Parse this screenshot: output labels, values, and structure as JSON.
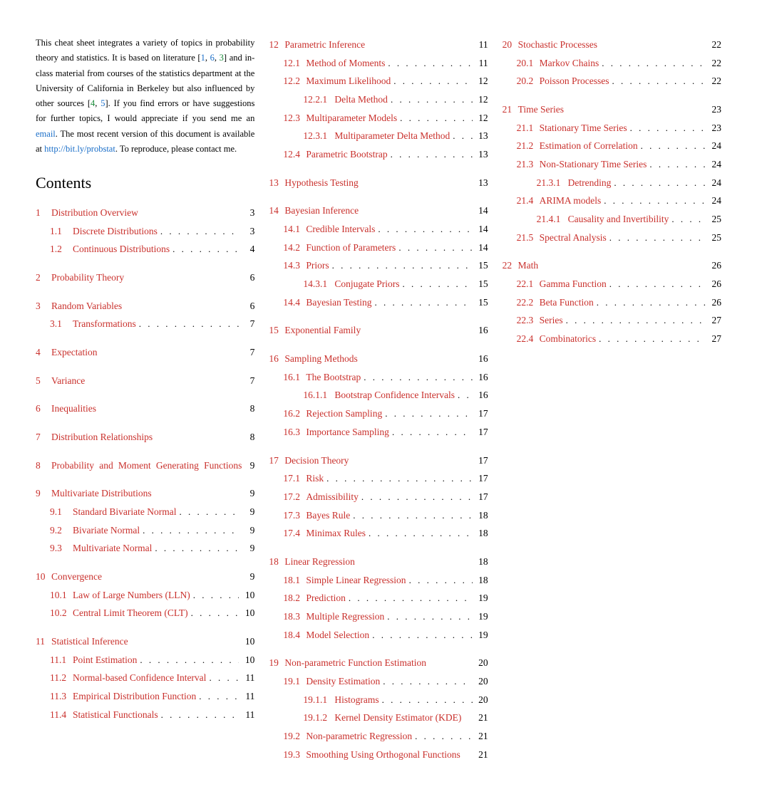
{
  "intro": {
    "p1a": "This cheat sheet integrates a variety of topics in probability theory and statistics. It is based on literature [",
    "cite1": "1",
    "cite2": "6",
    "cite3": "3",
    "p1b": "] and in-class material from courses of the statistics department at the University of California in Berkeley but also influenced by other sources [",
    "cite4": "4",
    "cite5": "5",
    "p1c": "]. If you find errors or have suggestions for further topics, I would appreciate if you send me an ",
    "email": "email",
    "p1d": ". The most recent version of this document is available at ",
    "url": "http://bit.ly/probstat",
    "p1e": ". To reproduce, please contact me."
  },
  "contents_title": "Contents",
  "cols": [
    [
      {
        "type": "sec",
        "items": [
          {
            "l": 0,
            "n": "1",
            "t": "Distribution Overview",
            "p": "3",
            "nodot": true
          },
          {
            "l": 1,
            "n": "1.1",
            "t": "Discrete Distributions",
            "p": "3"
          },
          {
            "l": 1,
            "n": "1.2",
            "t": "Continuous Distributions",
            "p": "4"
          }
        ]
      },
      {
        "type": "sec",
        "items": [
          {
            "l": 0,
            "n": "2",
            "t": "Probability Theory",
            "p": "6",
            "nodot": true
          }
        ]
      },
      {
        "type": "sec",
        "items": [
          {
            "l": 0,
            "n": "3",
            "t": "Random Variables",
            "p": "6",
            "nodot": true
          },
          {
            "l": 1,
            "n": "3.1",
            "t": "Transformations",
            "p": "7"
          }
        ]
      },
      {
        "type": "sec",
        "items": [
          {
            "l": 0,
            "n": "4",
            "t": "Expectation",
            "p": "7",
            "nodot": true
          }
        ]
      },
      {
        "type": "sec",
        "items": [
          {
            "l": 0,
            "n": "5",
            "t": "Variance",
            "p": "7",
            "nodot": true
          }
        ]
      },
      {
        "type": "sec",
        "items": [
          {
            "l": 0,
            "n": "6",
            "t": "Inequalities",
            "p": "8",
            "nodot": true
          }
        ]
      },
      {
        "type": "sec",
        "items": [
          {
            "l": 0,
            "n": "7",
            "t": "Distribution Relationships",
            "p": "8",
            "nodot": true
          }
        ]
      },
      {
        "type": "sec",
        "items": [
          {
            "l": 0,
            "n": "8",
            "t": "Probability and Moment Generating Functions",
            "p": "9",
            "nodot": true,
            "wrap": true,
            "justify": true
          }
        ]
      },
      {
        "type": "sec",
        "items": [
          {
            "l": 0,
            "n": "9",
            "t": "Multivariate Distributions",
            "p": "9",
            "nodot": true
          },
          {
            "l": 1,
            "n": "9.1",
            "t": "Standard Bivariate Normal",
            "p": "9"
          },
          {
            "l": 1,
            "n": "9.2",
            "t": "Bivariate Normal",
            "p": "9"
          },
          {
            "l": 1,
            "n": "9.3",
            "t": "Multivariate Normal",
            "p": "9"
          }
        ]
      },
      {
        "type": "sec",
        "items": [
          {
            "l": 0,
            "n": "10",
            "t": "Convergence",
            "p": "9",
            "nodot": true
          },
          {
            "l": 1,
            "n": "10.1",
            "t": "Law of Large Numbers (LLN)",
            "p": "10"
          },
          {
            "l": 1,
            "n": "10.2",
            "t": "Central Limit Theorem (CLT)",
            "p": "10"
          }
        ]
      },
      {
        "type": "sec",
        "items": [
          {
            "l": 0,
            "n": "11",
            "t": "Statistical Inference",
            "p": "10",
            "nodot": true
          },
          {
            "l": 1,
            "n": "11.1",
            "t": "Point Estimation",
            "p": "10"
          },
          {
            "l": 1,
            "n": "11.2",
            "t": "Normal-based Confidence Interval",
            "p": "11"
          },
          {
            "l": 1,
            "n": "11.3",
            "t": "Empirical Distribution Function",
            "p": "11"
          },
          {
            "l": 1,
            "n": "11.4",
            "t": "Statistical Functionals",
            "p": "11"
          }
        ]
      }
    ],
    [
      {
        "type": "sec",
        "items": [
          {
            "l": 0,
            "n": "12",
            "t": "Parametric Inference",
            "p": "11",
            "nodot": true
          },
          {
            "l": 1,
            "n": "12.1",
            "t": "Method of Moments",
            "p": "11"
          },
          {
            "l": 1,
            "n": "12.2",
            "t": "Maximum Likelihood",
            "p": "12"
          },
          {
            "l": 2,
            "n": "12.2.1",
            "t": "Delta Method",
            "p": "12"
          },
          {
            "l": 1,
            "n": "12.3",
            "t": "Multiparameter Models",
            "p": "12"
          },
          {
            "l": 2,
            "n": "12.3.1",
            "t": "Multiparameter Delta Method",
            "p": "13"
          },
          {
            "l": 1,
            "n": "12.4",
            "t": "Parametric Bootstrap",
            "p": "13"
          }
        ]
      },
      {
        "type": "sec",
        "items": [
          {
            "l": 0,
            "n": "13",
            "t": "Hypothesis Testing",
            "p": "13",
            "nodot": true
          }
        ]
      },
      {
        "type": "sec",
        "items": [
          {
            "l": 0,
            "n": "14",
            "t": "Bayesian Inference",
            "p": "14",
            "nodot": true
          },
          {
            "l": 1,
            "n": "14.1",
            "t": "Credible Intervals",
            "p": "14"
          },
          {
            "l": 1,
            "n": "14.2",
            "t": "Function of Parameters",
            "p": "14"
          },
          {
            "l": 1,
            "n": "14.3",
            "t": "Priors",
            "p": "15"
          },
          {
            "l": 2,
            "n": "14.3.1",
            "t": "Conjugate Priors",
            "p": "15"
          },
          {
            "l": 1,
            "n": "14.4",
            "t": "Bayesian Testing",
            "p": "15"
          }
        ]
      },
      {
        "type": "sec",
        "items": [
          {
            "l": 0,
            "n": "15",
            "t": "Exponential Family",
            "p": "16",
            "nodot": true
          }
        ]
      },
      {
        "type": "sec",
        "items": [
          {
            "l": 0,
            "n": "16",
            "t": "Sampling Methods",
            "p": "16",
            "nodot": true
          },
          {
            "l": 1,
            "n": "16.1",
            "t": "The Bootstrap",
            "p": "16"
          },
          {
            "l": 2,
            "n": "16.1.1",
            "t": "Bootstrap Confidence Intervals",
            "p": "16"
          },
          {
            "l": 1,
            "n": "16.2",
            "t": "Rejection Sampling",
            "p": "17"
          },
          {
            "l": 1,
            "n": "16.3",
            "t": "Importance Sampling",
            "p": "17"
          }
        ]
      },
      {
        "type": "sec",
        "items": [
          {
            "l": 0,
            "n": "17",
            "t": "Decision Theory",
            "p": "17",
            "nodot": true
          },
          {
            "l": 1,
            "n": "17.1",
            "t": "Risk",
            "p": "17"
          },
          {
            "l": 1,
            "n": "17.2",
            "t": "Admissibility",
            "p": "17"
          },
          {
            "l": 1,
            "n": "17.3",
            "t": "Bayes Rule",
            "p": "18"
          },
          {
            "l": 1,
            "n": "17.4",
            "t": "Minimax Rules",
            "p": "18"
          }
        ]
      },
      {
        "type": "sec",
        "items": [
          {
            "l": 0,
            "n": "18",
            "t": "Linear Regression",
            "p": "18",
            "nodot": true
          },
          {
            "l": 1,
            "n": "18.1",
            "t": "Simple Linear Regression",
            "p": "18"
          },
          {
            "l": 1,
            "n": "18.2",
            "t": "Prediction",
            "p": "19"
          },
          {
            "l": 1,
            "n": "18.3",
            "t": "Multiple Regression",
            "p": "19"
          },
          {
            "l": 1,
            "n": "18.4",
            "t": "Model Selection",
            "p": "19"
          }
        ]
      },
      {
        "type": "sec",
        "items": [
          {
            "l": 0,
            "n": "19",
            "t": "Non-parametric Function Estimation",
            "p": "20",
            "nodot": true
          },
          {
            "l": 1,
            "n": "19.1",
            "t": "Density Estimation",
            "p": "20"
          },
          {
            "l": 2,
            "n": "19.1.1",
            "t": "Histograms",
            "p": "20"
          },
          {
            "l": 2,
            "n": "19.1.2",
            "t": "Kernel Density Estimator (KDE)",
            "p": "21",
            "nodot": true
          },
          {
            "l": 1,
            "n": "19.2",
            "t": "Non-parametric Regression",
            "p": "21"
          },
          {
            "l": 1,
            "n": "19.3",
            "t": "Smoothing Using Orthogonal Functions",
            "p": "21",
            "nodot": true
          }
        ]
      }
    ],
    [
      {
        "type": "sec",
        "items": [
          {
            "l": 0,
            "n": "20",
            "t": "Stochastic Processes",
            "p": "22",
            "nodot": true
          },
          {
            "l": 1,
            "n": "20.1",
            "t": "Markov Chains",
            "p": "22"
          },
          {
            "l": 1,
            "n": "20.2",
            "t": "Poisson Processes",
            "p": "22"
          }
        ]
      },
      {
        "type": "sec",
        "items": [
          {
            "l": 0,
            "n": "21",
            "t": "Time Series",
            "p": "23",
            "nodot": true
          },
          {
            "l": 1,
            "n": "21.1",
            "t": "Stationary Time Series",
            "p": "23"
          },
          {
            "l": 1,
            "n": "21.2",
            "t": "Estimation of Correlation",
            "p": "24"
          },
          {
            "l": 1,
            "n": "21.3",
            "t": "Non-Stationary Time Series",
            "p": "24"
          },
          {
            "l": 2,
            "n": "21.3.1",
            "t": "Detrending",
            "p": "24"
          },
          {
            "l": 1,
            "n": "21.4",
            "t": "ARIMA models",
            "p": "24"
          },
          {
            "l": 2,
            "n": "21.4.1",
            "t": "Causality and Invertibility",
            "p": "25"
          },
          {
            "l": 1,
            "n": "21.5",
            "t": "Spectral Analysis",
            "p": "25"
          }
        ]
      },
      {
        "type": "sec",
        "items": [
          {
            "l": 0,
            "n": "22",
            "t": "Math",
            "p": "26",
            "nodot": true
          },
          {
            "l": 1,
            "n": "22.1",
            "t": "Gamma Function",
            "p": "26"
          },
          {
            "l": 1,
            "n": "22.2",
            "t": "Beta Function",
            "p": "26"
          },
          {
            "l": 1,
            "n": "22.3",
            "t": "Series",
            "p": "27"
          },
          {
            "l": 1,
            "n": "22.4",
            "t": "Combinatorics",
            "p": "27"
          }
        ]
      }
    ]
  ]
}
